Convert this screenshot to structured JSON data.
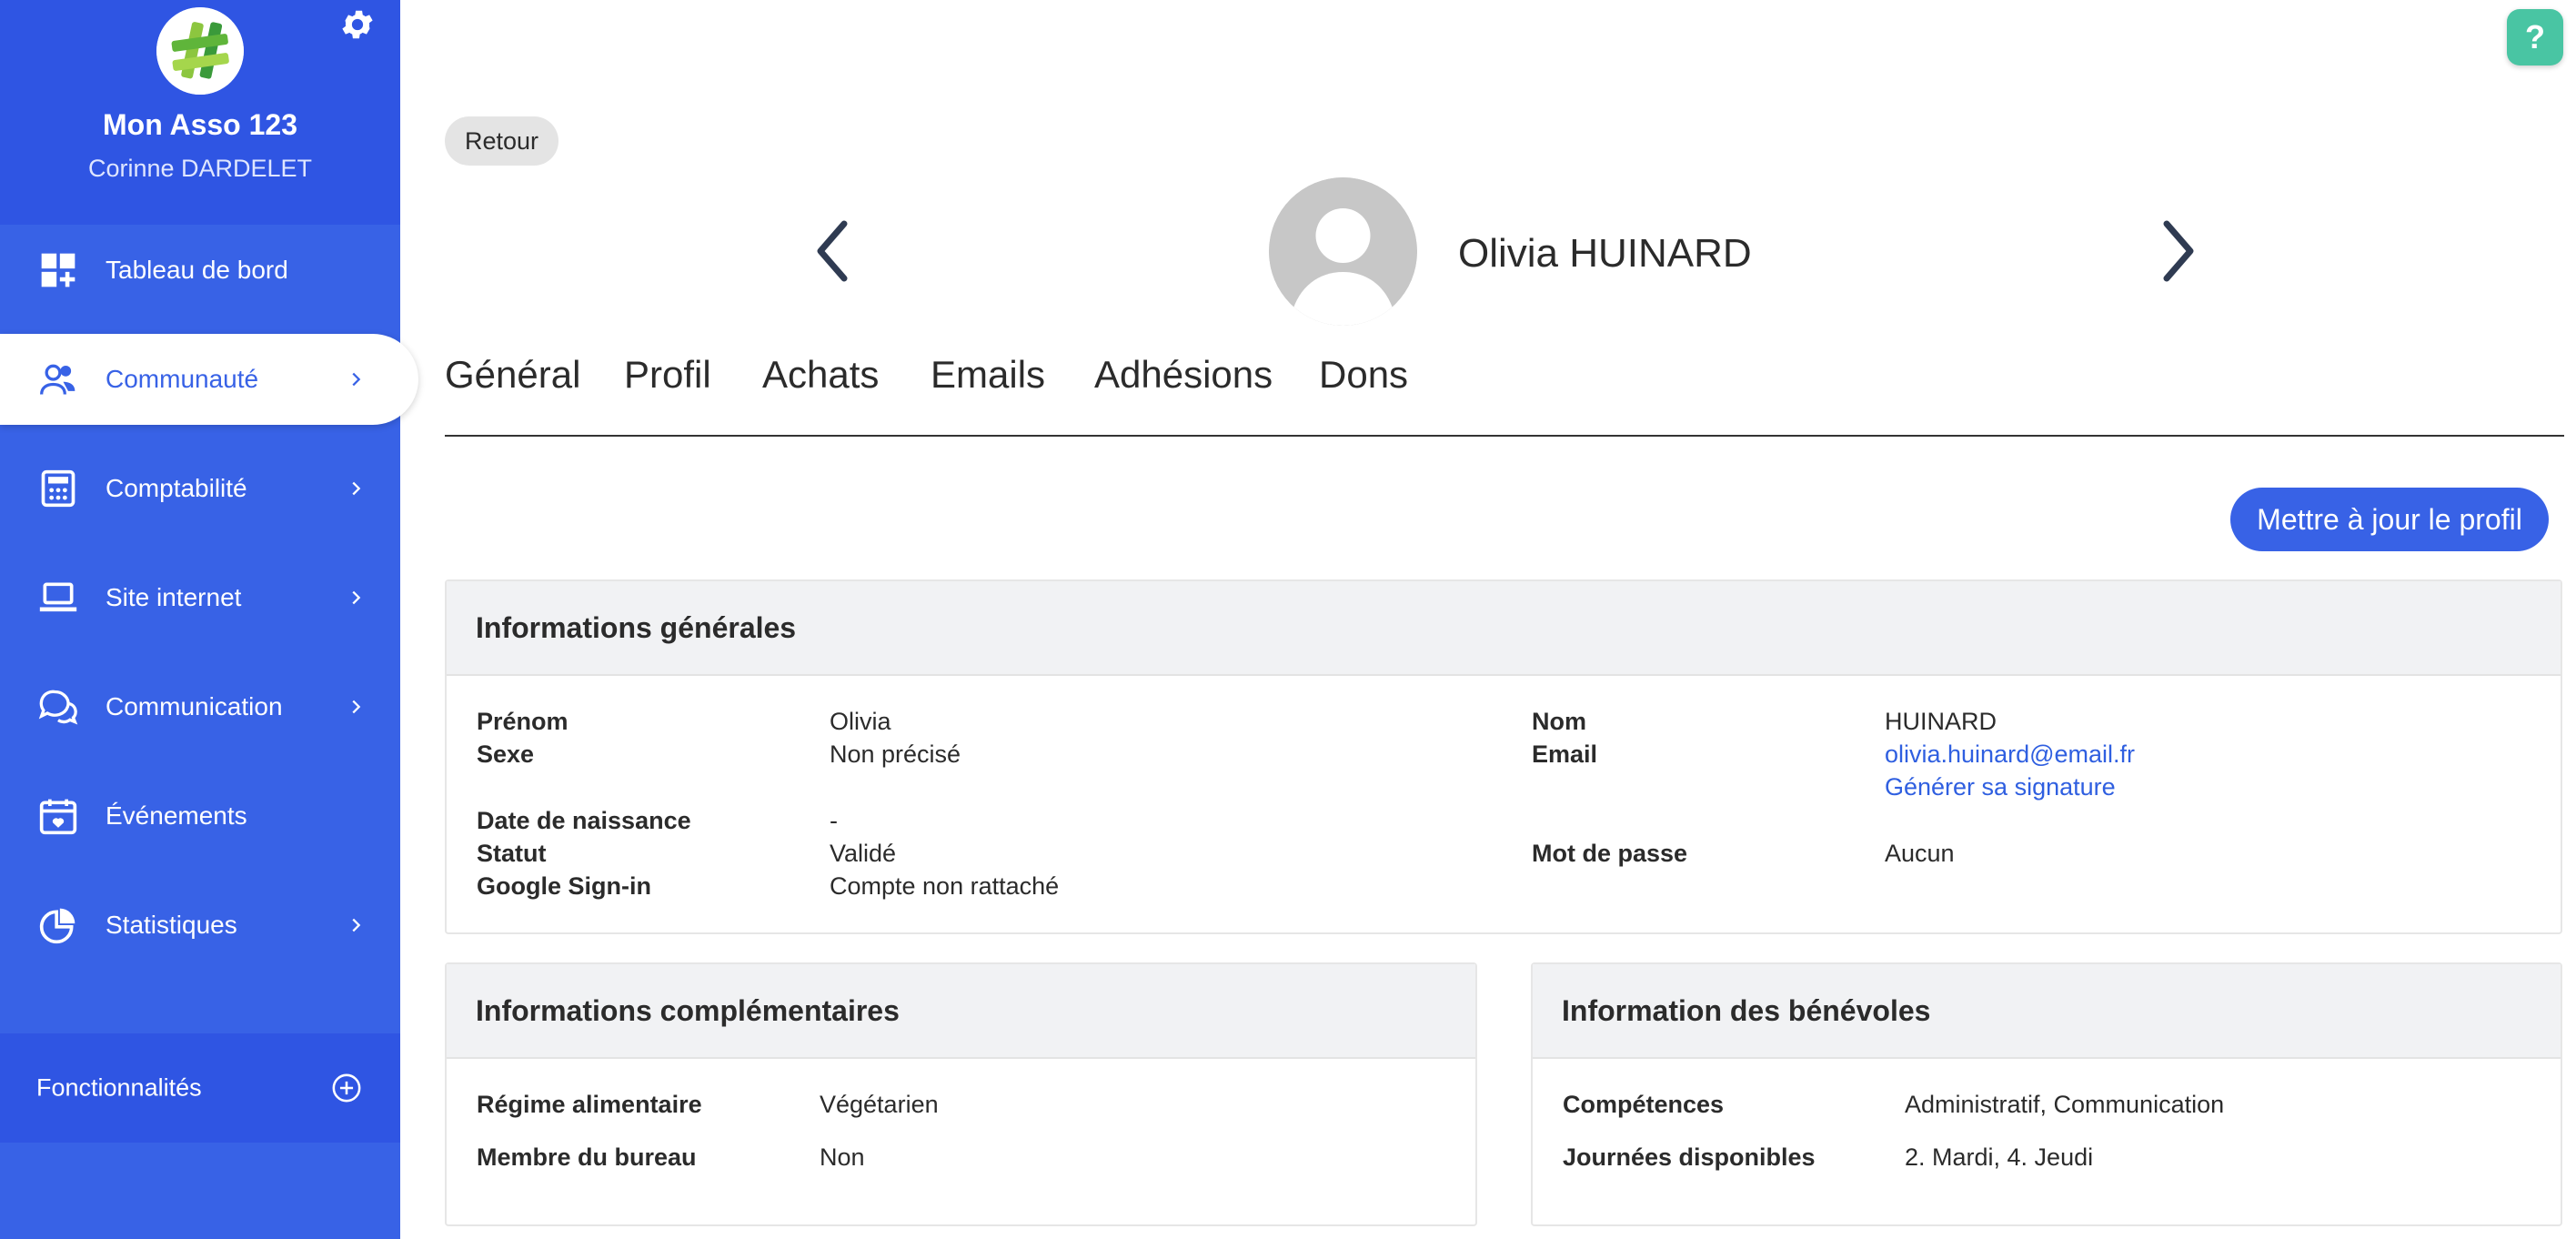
{
  "sidebar": {
    "org_name": "Mon Asso 123",
    "user_name": "Corinne DARDELET",
    "logo_icon": "hashtag-logo",
    "settings_icon": "gear-icon",
    "items": [
      {
        "label": "Tableau de bord",
        "icon": "dashboard-icon",
        "chevron": false
      },
      {
        "label": "Communauté",
        "icon": "users-icon",
        "chevron": true,
        "active": true
      },
      {
        "label": "Comptabilité",
        "icon": "calculator-icon",
        "chevron": true
      },
      {
        "label": "Site internet",
        "icon": "laptop-icon",
        "chevron": true
      },
      {
        "label": "Communication",
        "icon": "chat-icon",
        "chevron": true
      },
      {
        "label": "Événements",
        "icon": "calendar-icon",
        "chevron": false
      },
      {
        "label": "Statistiques",
        "icon": "pie-chart-icon",
        "chevron": true
      }
    ],
    "features_label": "Fonctionnalités",
    "features_icon": "plus-circle-icon"
  },
  "help": {
    "label": "?"
  },
  "header": {
    "back_label": "Retour",
    "member_name": "Olivia HUINARD"
  },
  "tabs": [
    "Général",
    "Profil",
    "Achats",
    "Emails",
    "Adhésions",
    "Dons"
  ],
  "update_button": "Mettre à jour le profil",
  "general": {
    "title": "Informations générales",
    "left": [
      {
        "label": "Prénom",
        "value": "Olivia"
      },
      {
        "label": "Sexe",
        "value": "Non précisé"
      },
      {
        "label": "Date de naissance",
        "value": "-"
      },
      {
        "label": "Statut",
        "value": "Validé"
      },
      {
        "label": "Google Sign-in",
        "value": "Compte non rattaché"
      }
    ],
    "right": {
      "nom_label": "Nom",
      "nom_value": "HUINARD",
      "email_label": "Email",
      "email_value": "olivia.huinard@email.fr",
      "signature_link": "Générer sa signature",
      "password_label": "Mot de passe",
      "password_value": "Aucun"
    }
  },
  "extra": {
    "title": "Informations complémentaires",
    "rows": [
      {
        "label": "Régime alimentaire",
        "value": "Végétarien"
      },
      {
        "label": "Membre du bureau",
        "value": "Non"
      }
    ]
  },
  "volunteers": {
    "title": "Information des bénévoles",
    "rows": [
      {
        "label": "Compétences",
        "value": "Administratif, Communication"
      },
      {
        "label": "Journées disponibles",
        "value": "2. Mardi, 4. Jeudi"
      }
    ]
  },
  "colors": {
    "primary": "#3862e6",
    "sidebar_dark": "#2f55e3",
    "help": "#49c5a3",
    "link": "#2f5fe0"
  }
}
